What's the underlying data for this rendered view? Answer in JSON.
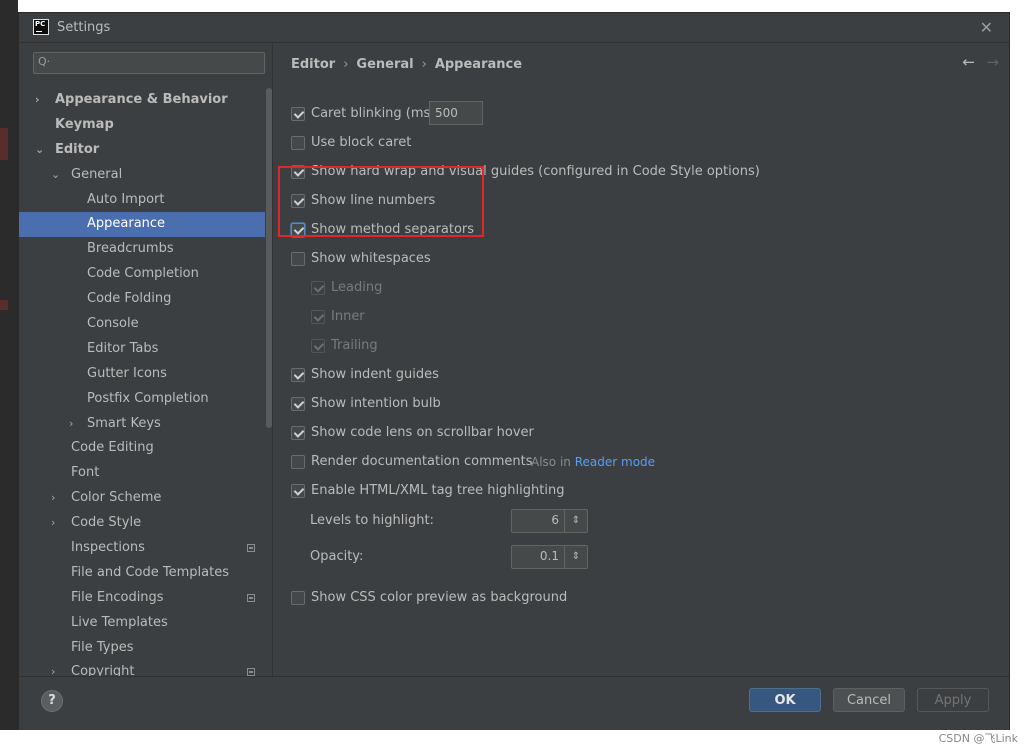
{
  "window": {
    "title": "Settings",
    "app_icon_text": "PC",
    "close_symbol": "✕"
  },
  "search": {
    "placeholder": "",
    "value": ""
  },
  "sidebar": {
    "items": [
      {
        "label": "Appearance & Behavior",
        "arrow": "›",
        "level": 0,
        "bold": true
      },
      {
        "label": "Keymap",
        "arrow": "",
        "level": 0,
        "bold": true
      },
      {
        "label": "Editor",
        "arrow": "⌄",
        "level": 0,
        "bold": true
      },
      {
        "label": "General",
        "arrow": "⌄",
        "level": 1
      },
      {
        "label": "Auto Import",
        "arrow": "",
        "level": 2
      },
      {
        "label": "Appearance",
        "arrow": "",
        "level": 2,
        "selected": true
      },
      {
        "label": "Breadcrumbs",
        "arrow": "",
        "level": 2
      },
      {
        "label": "Code Completion",
        "arrow": "",
        "level": 2
      },
      {
        "label": "Code Folding",
        "arrow": "",
        "level": 2
      },
      {
        "label": "Console",
        "arrow": "",
        "level": 2
      },
      {
        "label": "Editor Tabs",
        "arrow": "",
        "level": 2
      },
      {
        "label": "Gutter Icons",
        "arrow": "",
        "level": 2
      },
      {
        "label": "Postfix Completion",
        "arrow": "",
        "level": 2
      },
      {
        "label": "Smart Keys",
        "arrow": "›",
        "level": 2
      },
      {
        "label": "Code Editing",
        "arrow": "",
        "level": 1
      },
      {
        "label": "Font",
        "arrow": "",
        "level": 1
      },
      {
        "label": "Color Scheme",
        "arrow": "›",
        "level": 1
      },
      {
        "label": "Code Style",
        "arrow": "›",
        "level": 1
      },
      {
        "label": "Inspections",
        "arrow": "",
        "level": 1,
        "project": true
      },
      {
        "label": "File and Code Templates",
        "arrow": "",
        "level": 1
      },
      {
        "label": "File Encodings",
        "arrow": "",
        "level": 1,
        "project": true
      },
      {
        "label": "Live Templates",
        "arrow": "",
        "level": 1
      },
      {
        "label": "File Types",
        "arrow": "",
        "level": 1
      },
      {
        "label": "Copyright",
        "arrow": "›",
        "level": 1,
        "project": true
      }
    ]
  },
  "breadcrumb": {
    "parts": [
      "Editor",
      "General",
      "Appearance"
    ],
    "separator": "›",
    "back": "←",
    "forward": "→"
  },
  "options": {
    "caret_blinking": {
      "label": "Caret blinking (ms):",
      "checked": true,
      "value": "500"
    },
    "block_caret": {
      "label": "Use block caret",
      "checked": false
    },
    "hard_wrap": {
      "label": "Show hard wrap and visual guides (configured in Code Style options)",
      "checked": true
    },
    "line_numbers": {
      "label": "Show line numbers",
      "checked": true
    },
    "method_separators": {
      "label": "Show method separators",
      "checked": true
    },
    "whitespaces": {
      "label": "Show whitespaces",
      "checked": false
    },
    "leading": {
      "label": "Leading",
      "checked": true,
      "disabled": true
    },
    "inner": {
      "label": "Inner",
      "checked": true,
      "disabled": true
    },
    "trailing": {
      "label": "Trailing",
      "checked": true,
      "disabled": true
    },
    "indent_guides": {
      "label": "Show indent guides",
      "checked": true
    },
    "intention_bulb": {
      "label": "Show intention bulb",
      "checked": true
    },
    "code_lens": {
      "label": "Show code lens on scrollbar hover",
      "checked": true
    },
    "render_docs": {
      "label": "Render documentation comments",
      "checked": false,
      "also_prefix": "Also in",
      "also_link": "Reader mode"
    },
    "tag_tree": {
      "label": "Enable HTML/XML tag tree highlighting",
      "checked": true
    },
    "css_preview": {
      "label": "Show CSS color preview as background",
      "checked": false
    }
  },
  "spinners": {
    "levels": {
      "label": "Levels to highlight:",
      "value": "6"
    },
    "opacity": {
      "label": "Opacity:",
      "value": "0.1"
    },
    "arrow_symbol": "⇕"
  },
  "footer": {
    "help": "?",
    "ok": "OK",
    "cancel": "Cancel",
    "apply": "Apply"
  },
  "watermark": "CSDN @飞Link",
  "colors": {
    "selection": "#4b6eaf",
    "highlight_box": "#e0272c",
    "link": "#589df6",
    "ok_button": "#365880"
  }
}
